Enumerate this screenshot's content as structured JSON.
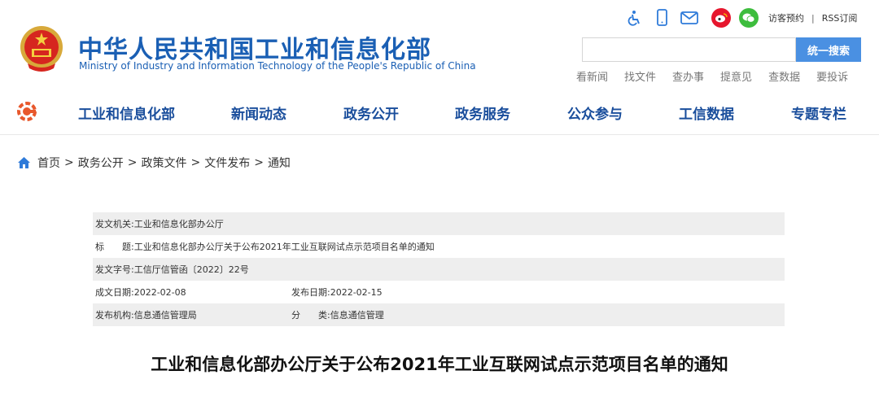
{
  "header": {
    "title_cn": "中华人民共和国工业和信息化部",
    "title_en": "Ministry of Industry and Information Technology of the People's Republic of China",
    "emblem_icon": "national-emblem-icon",
    "tool_icons": [
      "accessibility-icon",
      "mobile-icon",
      "mail-icon",
      "weibo-icon",
      "wechat-icon"
    ],
    "visit_label": "访客预约",
    "rss_label": "RSS订阅",
    "separator": "|"
  },
  "search": {
    "value": "",
    "button_label": "统一搜索"
  },
  "quick_links": [
    "看新闻",
    "找文件",
    "查办事",
    "提意见",
    "查数据",
    "要投诉"
  ],
  "nav": {
    "items": [
      "工业和信息化部",
      "新闻动态",
      "政务公开",
      "政务服务",
      "公众参与",
      "工信数据",
      "专题专栏"
    ]
  },
  "breadcrumb": {
    "items": [
      "首页",
      "政务公开",
      "政策文件",
      "文件发布",
      "通知"
    ],
    "separator": ">"
  },
  "info": {
    "issuer_label": "发文机关:",
    "issuer": "工业和信息化部办公厅",
    "title_label": "标　　题:",
    "title": "工业和信息化部办公厅关于公布2021年工业互联网试点示范项目名单的通知",
    "docno_label": "发文字号:",
    "docno": "工信厅信管函〔2022〕22号",
    "created_label": "成文日期:",
    "created": "2022-02-08",
    "published_label": "发布日期:",
    "published": "2022-02-15",
    "org_label": "发布机构:",
    "org": "信息通信管理局",
    "category_label": "分　　类:",
    "category": "信息通信管理"
  },
  "document": {
    "title": "工业和信息化部办公厅关于公布2021年工业互联网试点示范项目名单的通知"
  },
  "colors": {
    "brand_blue": "#1a5fb4",
    "nav_blue": "#1a4e9c",
    "search_button": "#4a90e2",
    "weibo": "#e6162d",
    "wechat": "#3dbd3d",
    "row_shade": "#eeeeee"
  }
}
